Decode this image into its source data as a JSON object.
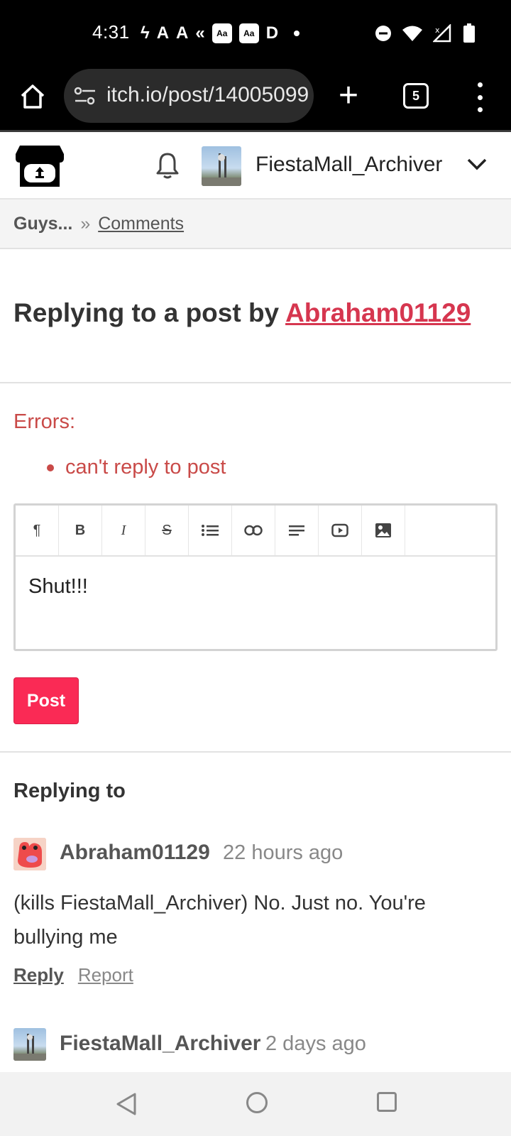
{
  "status_bar": {
    "time": "4:31",
    "tabs_count": "5"
  },
  "browser": {
    "url": "itch.io/post/14005099",
    "tab_count": "5"
  },
  "header": {
    "username": "FiestaMall_Archiver"
  },
  "breadcrumb": {
    "first": "Guys...",
    "separator": "»",
    "second": "Comments"
  },
  "page": {
    "title_prefix": "Replying to a post by",
    "title_user": "Abraham01129"
  },
  "errors": {
    "label": "Errors:",
    "items": [
      "can't reply to post"
    ]
  },
  "editor": {
    "content": "Shut!!!",
    "tools": [
      "paragraph-icon",
      "bold-icon",
      "italic-icon",
      "strikethrough-icon",
      "list-icon",
      "link-icon",
      "align-icon",
      "video-icon",
      "image-icon"
    ]
  },
  "post_button": {
    "label": "Post"
  },
  "replying_to": {
    "heading": "Replying to"
  },
  "comments": [
    {
      "user": "Abraham01129",
      "time": "22 hours ago",
      "body": "(kills FiestaMall_Archiver) No. Just no. You're bullying me",
      "reply_label": "Reply",
      "report_label": "Report"
    },
    {
      "user": "FiestaMall_Archiver",
      "time": "2 days ago"
    }
  ],
  "colors": {
    "accent": "#fa2a55",
    "link_red": "#d6364f",
    "error": "#c94a48"
  }
}
